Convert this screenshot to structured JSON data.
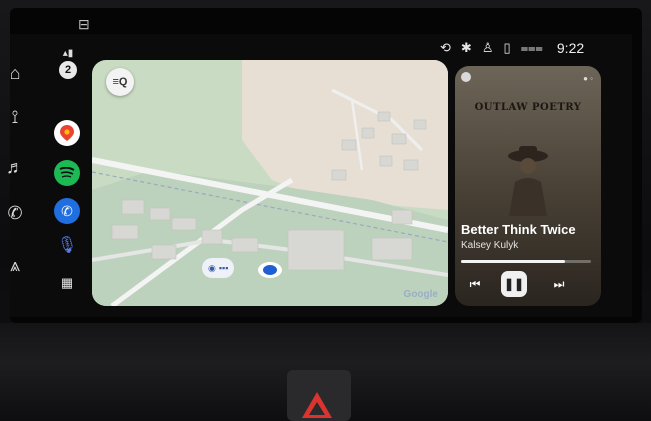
{
  "status_bar": {
    "time": "9:22",
    "icons": [
      "siri-icon",
      "bluetooth-icon",
      "person-icon",
      "phone-signal-icon",
      "wifi-signal-icon"
    ]
  },
  "carplay_sidebar": {
    "notification_count": "2",
    "apps": [
      {
        "name": "Google Maps",
        "icon": "maps-icon",
        "color": "#ffffff"
      },
      {
        "name": "Spotify",
        "icon": "spotify-icon",
        "color": "#1db954"
      },
      {
        "name": "Phone",
        "icon": "phone-icon",
        "color": "#1f6fe0"
      },
      {
        "name": "Siri",
        "icon": "microphone-icon",
        "color": "#5b7de8"
      }
    ]
  },
  "oem_sidebar": {
    "items": [
      "home-icon",
      "radio-icon",
      "music-icon",
      "phone-icon",
      "navigation-icon"
    ]
  },
  "map": {
    "search_label": "≡Q",
    "attribution": "Google"
  },
  "now_playing": {
    "album_title": "OUTLAW POETRY",
    "track": "Better Think Twice",
    "artist": "Kalsey Kulyk",
    "progress": 0.8,
    "controls": {
      "prev": "⏮",
      "play_pause": "❚❚",
      "next": "⏭"
    }
  },
  "colors": {
    "map_bg": "#c9dcc3",
    "road": "#e8e8e8",
    "building": "#d9d9d6",
    "accent_blue": "#1f5fd6",
    "hazard_red": "#d9342f"
  }
}
